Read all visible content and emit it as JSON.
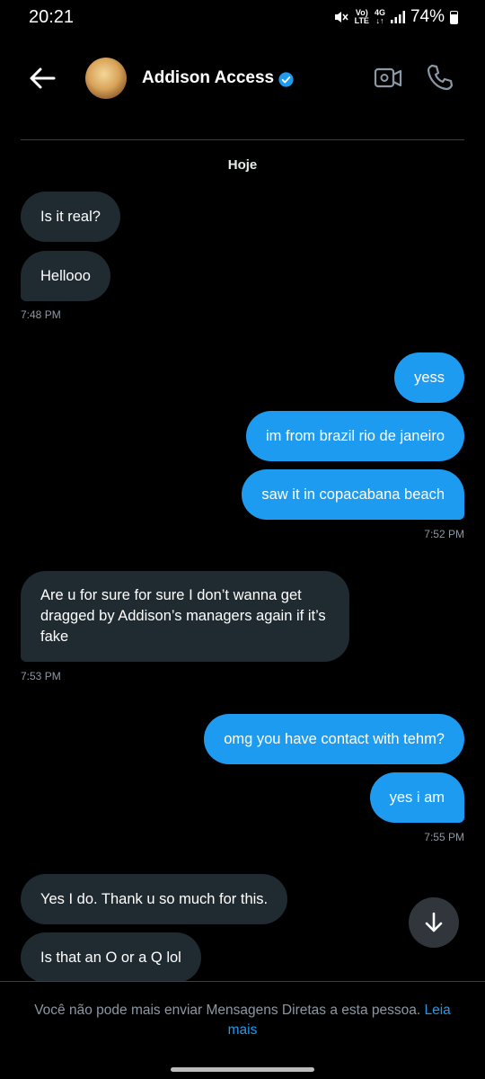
{
  "status_bar": {
    "time": "20:21",
    "network_top": "Vo)",
    "network_bottom": "LTE",
    "signal_top": "4G",
    "signal_bottom": "↓↑",
    "battery": "74%"
  },
  "header": {
    "contact_name": "Addison Access",
    "verified": true,
    "accent_color": "#1d9bf0"
  },
  "day_label": "Hoje",
  "messages": [
    {
      "side": "in",
      "text": "Is it real?"
    },
    {
      "side": "in",
      "text": "Hellooo"
    },
    {
      "side": "in",
      "time": "7:48 PM"
    },
    {
      "side": "out",
      "text": "yess"
    },
    {
      "side": "out",
      "text": "im from brazil rio de janeiro"
    },
    {
      "side": "out",
      "text": "saw it in copacabana beach"
    },
    {
      "side": "out",
      "time": "7:52 PM"
    },
    {
      "side": "in",
      "text": "Are u for sure for sure I don’t wanna get dragged by Addison’s managers again if it’s fake"
    },
    {
      "side": "in",
      "time": "7:53 PM"
    },
    {
      "side": "out",
      "text": "omg you have contact with tehm?"
    },
    {
      "side": "out",
      "text": "yes i am"
    },
    {
      "side": "out",
      "time": "7:55 PM"
    },
    {
      "side": "in",
      "text": "Yes I do. Thank u so much for this."
    },
    {
      "side": "in",
      "text": "Is that an O or a Q lol"
    }
  ],
  "footer": {
    "notice": "Você não pode mais enviar Mensagens Diretas a esta pessoa.",
    "link": "Leia mais"
  }
}
